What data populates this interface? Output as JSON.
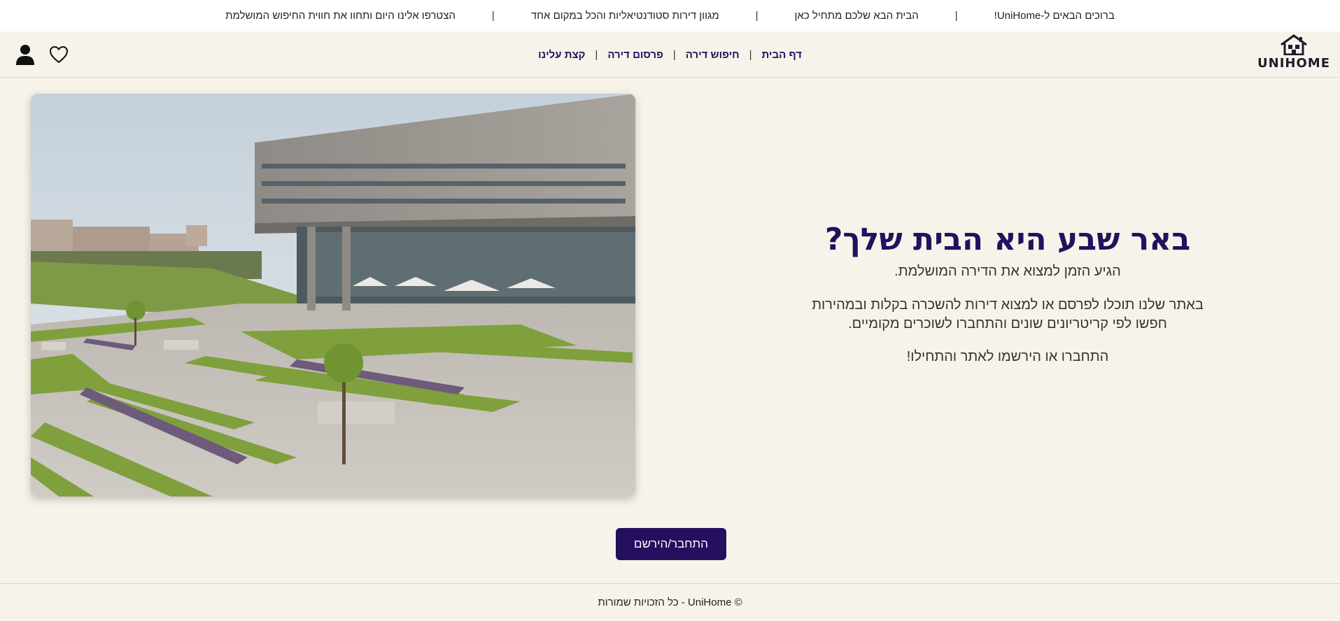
{
  "ticker": {
    "messages": [
      "ברוכים הבאים ל-UniHome!",
      "הבית הבא שלכם מתחיל כאן",
      "מגוון דירות סטודנטיאליות והכל במקום אחד",
      "הצטרפו אלינו היום ותחוו את חווית החיפוש המושלמת"
    ],
    "separator": "|"
  },
  "header": {
    "logo_text": "UNIHOME",
    "logo_icon": "house-icon",
    "nav": [
      {
        "label": "דף הבית"
      },
      {
        "label": "חיפוש דירה"
      },
      {
        "label": "פרסום דירה"
      },
      {
        "label": "קצת עלינו"
      }
    ],
    "nav_separator": "|",
    "icons": [
      "user-icon",
      "heart-icon"
    ]
  },
  "hero": {
    "title": "באר שבע היא הבית שלך?",
    "subtitle": "הגיע הזמן למצוא את הדירה המושלמת.",
    "body_line1": "באתר שלנו תוכלו לפרסם או למצוא דירות להשכרה בקלות ובמהירות",
    "body_line2": "חפשו לפי קריטריונים שונים והתחברו לשוכרים מקומיים.",
    "cta_text": "התחברו או הירשמו לאתר והתחילו!",
    "image_subject": "campus-building-photo"
  },
  "cta_button": {
    "label": "התחבר/הירשם"
  },
  "footer": {
    "text": "© UniHome - כל הזכויות שמורות"
  },
  "colors": {
    "background": "#f8f3ea",
    "primary": "#24105f",
    "ticker_bg": "#ffffff"
  }
}
